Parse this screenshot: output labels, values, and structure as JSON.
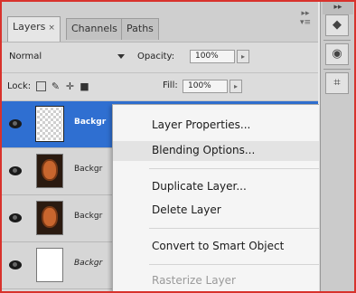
{
  "tabs": [
    {
      "label": "Layers",
      "close": "×"
    },
    {
      "label": "Channels"
    },
    {
      "label": "Paths"
    }
  ],
  "blend_mode": "Normal",
  "opacity": {
    "label": "Opacity:",
    "value": "100%"
  },
  "lock": {
    "label": "Lock:"
  },
  "fill": {
    "label": "Fill:",
    "value": "100%"
  },
  "layers": [
    {
      "name": "Backgr",
      "selected": true
    },
    {
      "name": "Backgr"
    },
    {
      "name": "Backgr"
    },
    {
      "name": "Backgr"
    }
  ],
  "context_menu": [
    "Layer Properties...",
    "Blending Options...",
    "Duplicate Layer...",
    "Delete Layer",
    "Convert to Smart Object",
    "Rasterize Layer"
  ],
  "colors": {
    "selection": "#2f6fd1",
    "frame_border": "#d8322c"
  }
}
